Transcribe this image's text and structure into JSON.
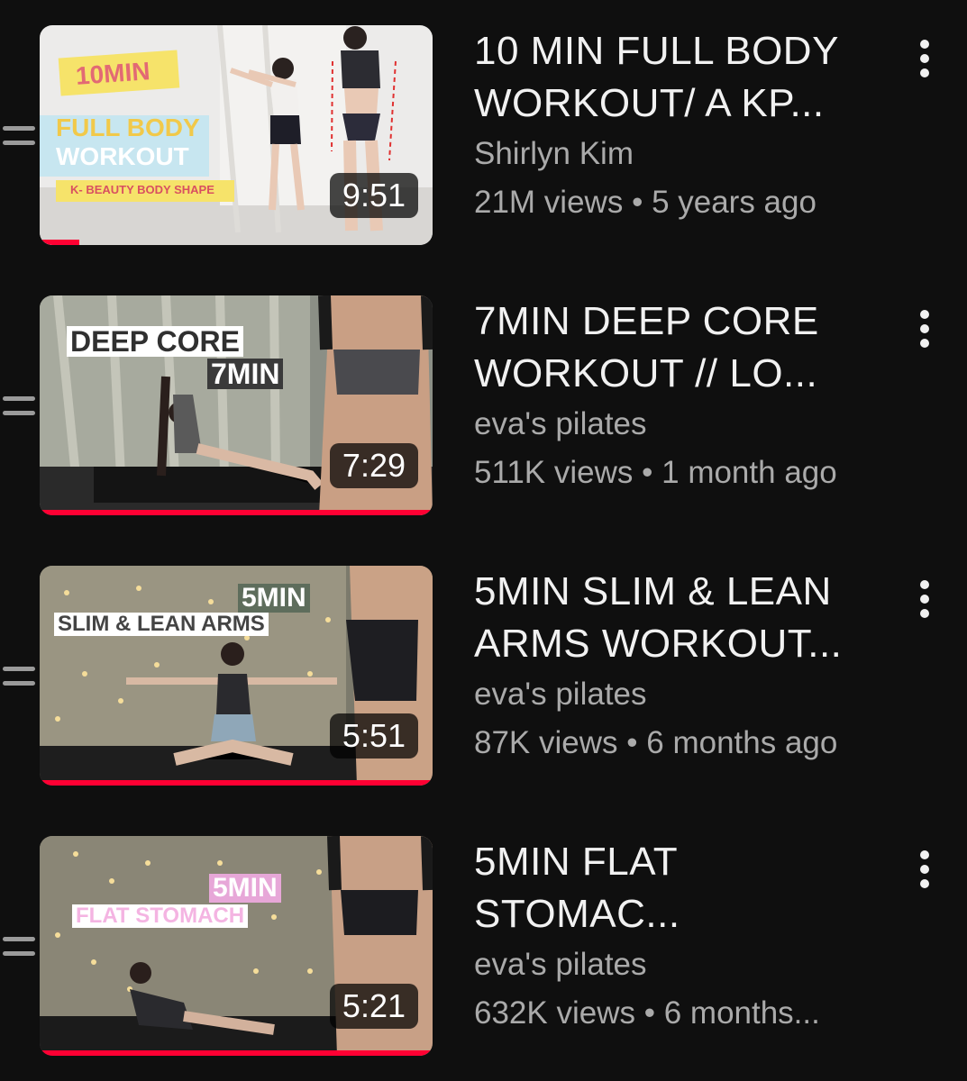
{
  "videos": [
    {
      "title_line1": "10 MIN FULL BODY",
      "title_line2": "WORKOUT/ A KP...",
      "channel": "Shirlyn Kim",
      "views": "21M views",
      "age": "5 years ago",
      "duration": "9:51",
      "watch_progress": 0.1,
      "thumb_text": [
        "10MIN",
        "FULL BODY",
        "WORKOUT",
        "K- BEAUTY BODY SHAPE"
      ]
    },
    {
      "title_line1": "7MIN DEEP CORE",
      "title_line2": "WORKOUT // LO...",
      "channel": "eva's pilates",
      "views": "511K views",
      "age": "1 month ago",
      "duration": "7:29",
      "watch_progress": 1.0,
      "thumb_text": [
        "DEEP CORE",
        "7MIN"
      ]
    },
    {
      "title_line1": "5MIN SLIM & LEAN",
      "title_line2": "ARMS WORKOUT...",
      "channel": "eva's pilates",
      "views": "87K views",
      "age": "6 months ago",
      "duration": "5:51",
      "watch_progress": 1.0,
      "thumb_text": [
        "5MIN",
        "SLIM & LEAN ARMS"
      ]
    },
    {
      "title_line1": "5MIN FLAT",
      "title_line2": "STOMAC...",
      "channel": "eva's pilates",
      "views": "632K views",
      "age": "6 months...",
      "duration": "5:21",
      "watch_progress": 1.0,
      "thumb_text": [
        "5MIN",
        "FLAT STOMACH"
      ]
    }
  ],
  "separator": "•",
  "colors": {
    "background": "#0f0f0f",
    "title": "#f1f1f1",
    "secondary": "#aaaaaa",
    "progress": "#ff0033"
  },
  "icons": [
    "drag-handle-icon",
    "more-vertical-icon"
  ]
}
